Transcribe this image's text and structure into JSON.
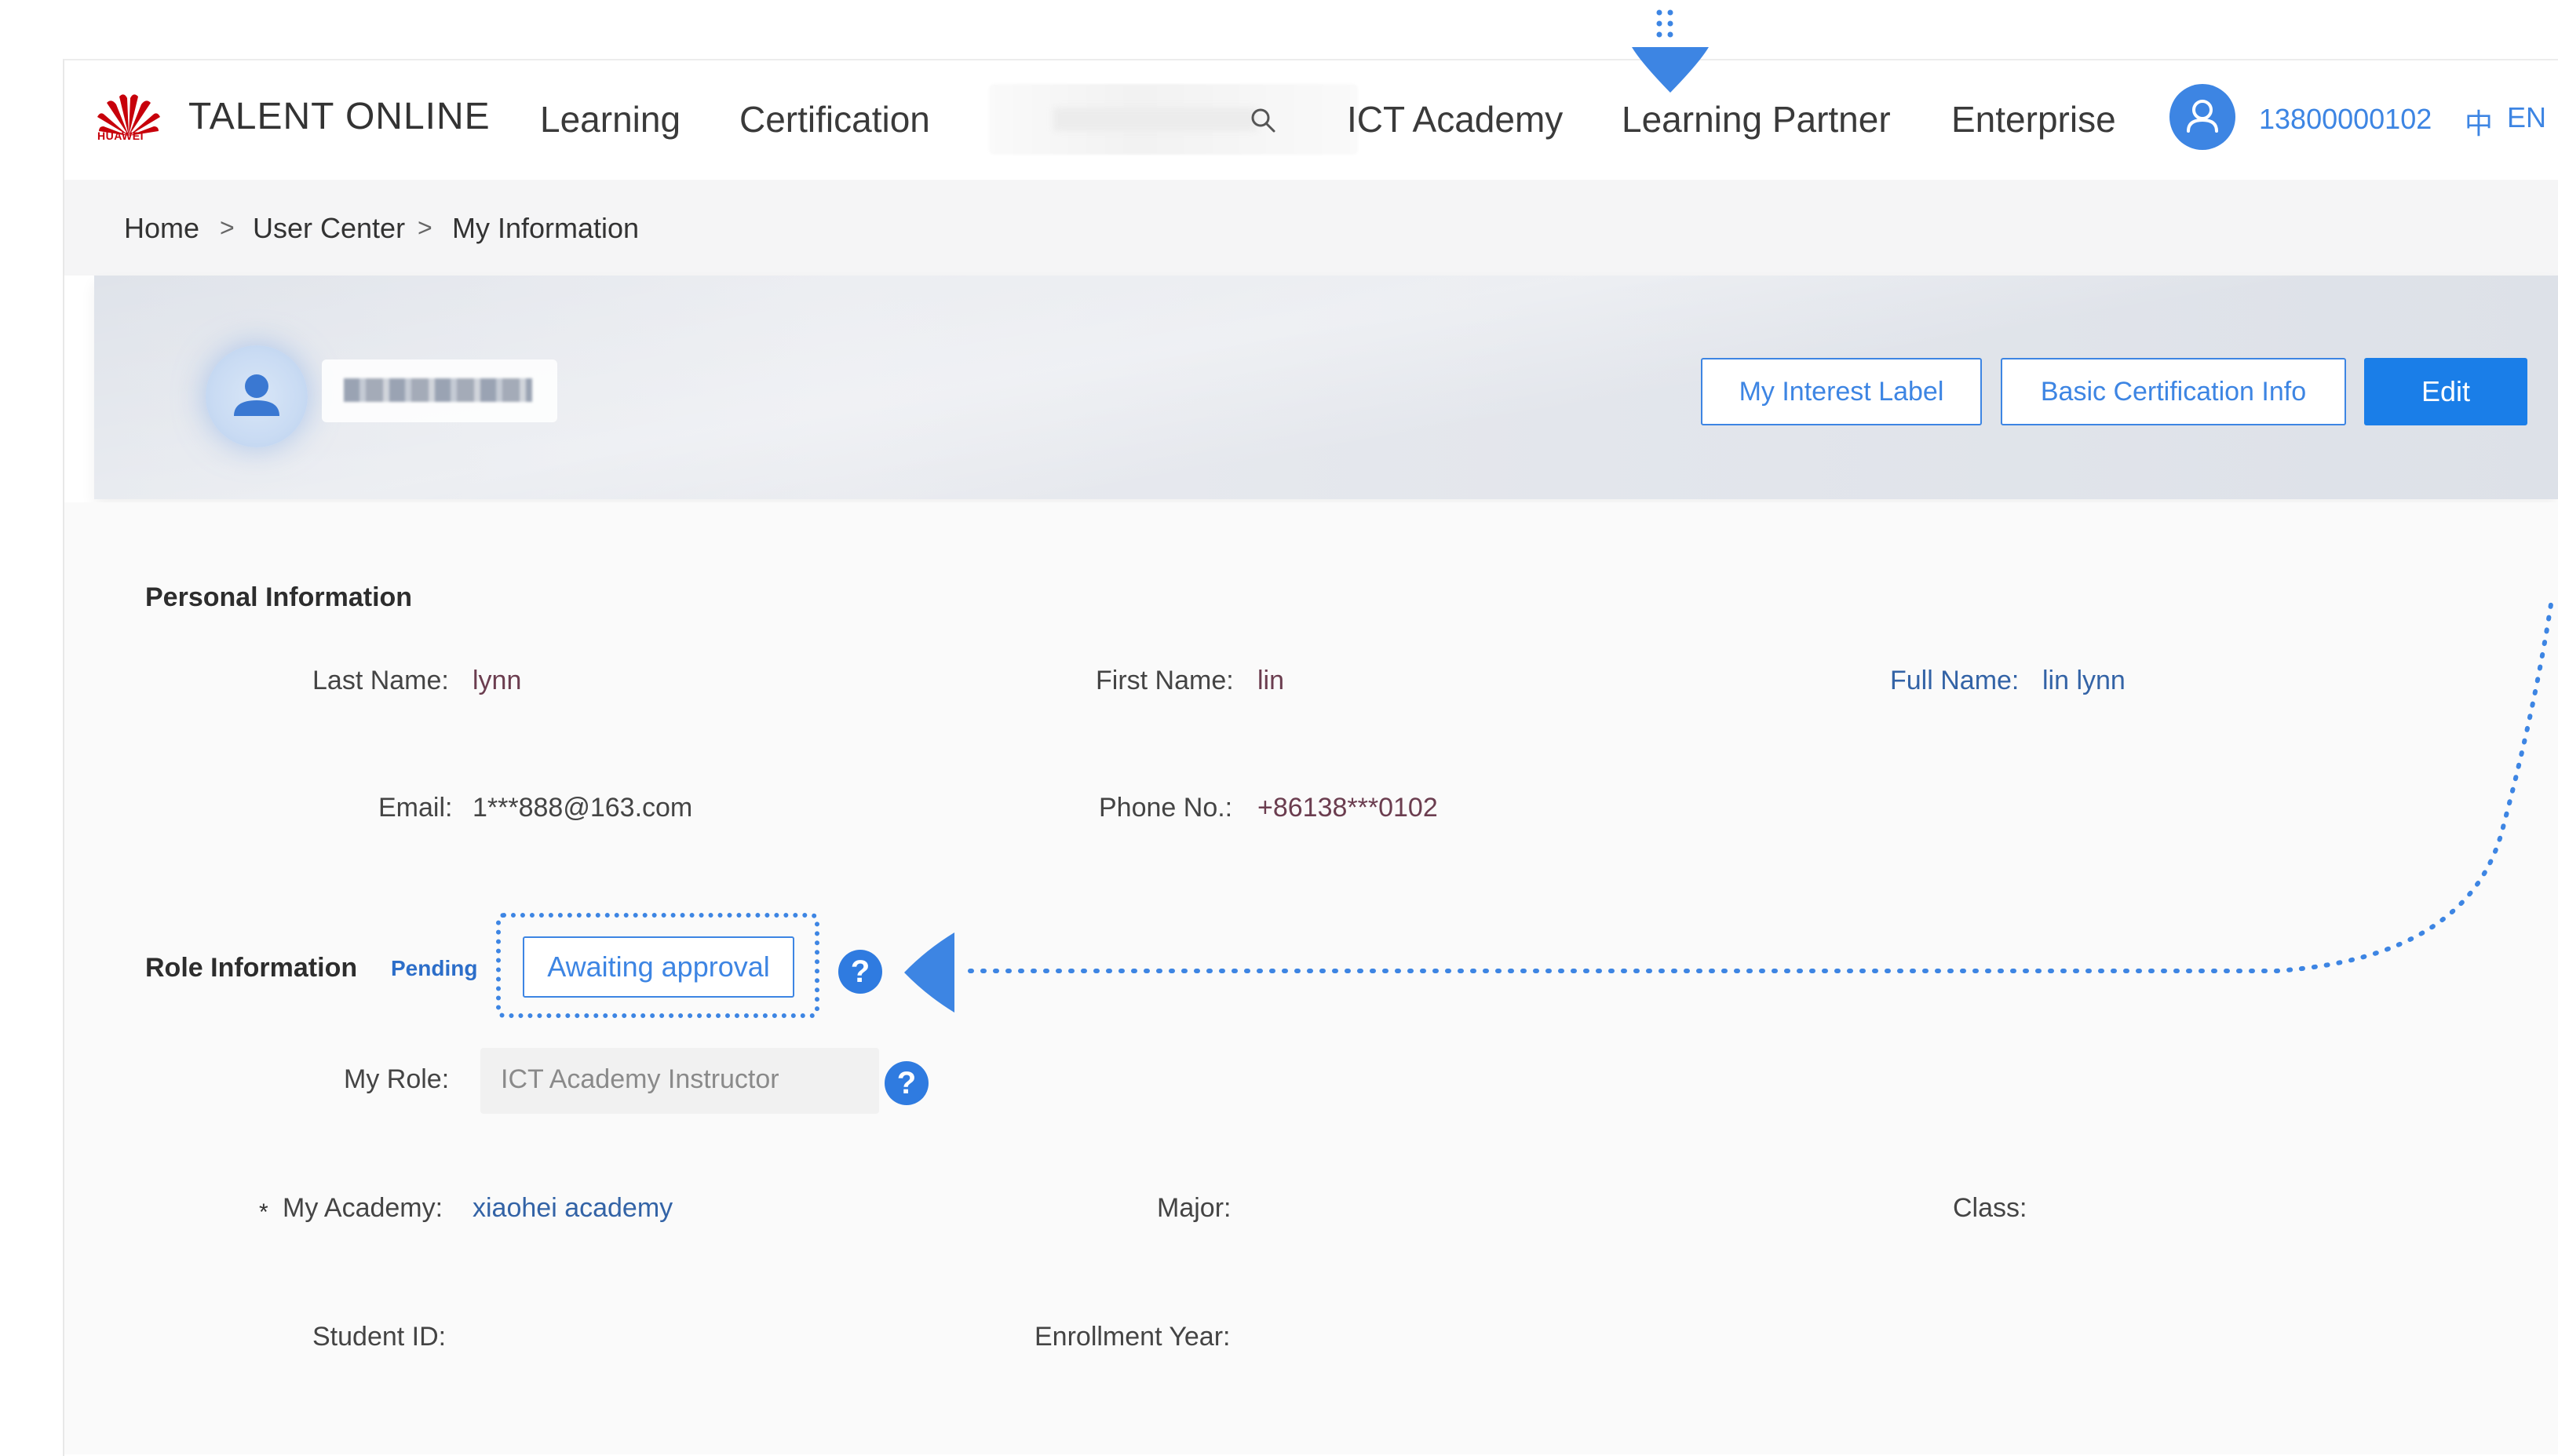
{
  "header": {
    "logo_text": "HUAWEI",
    "brand": "TALENT ONLINE",
    "nav": [
      "Learning",
      "Certification",
      "ICT Academy",
      "Learning Partner",
      "Enterprise"
    ],
    "user_phone": "13800000102",
    "lang_zh": "中",
    "lang_en": "EN"
  },
  "breadcrumb": {
    "items": [
      "Home",
      "User Center",
      "My Information"
    ],
    "separator": ">"
  },
  "banner": {
    "buttons": {
      "interest_label": "My Interest Label",
      "basic_cert": "Basic Certification Info",
      "edit": "Edit"
    }
  },
  "personal": {
    "title": "Personal Information",
    "last_name_label": "Last Name:",
    "last_name": "lynn",
    "first_name_label": "First Name:",
    "first_name": "lin",
    "full_name_label": "Full Name:",
    "full_name": "lin lynn",
    "email_label": "Email:",
    "email": "1***888@163.com",
    "phone_label": "Phone No.:",
    "phone": "+86138***0102"
  },
  "role": {
    "title": "Role Information",
    "status": "Pending",
    "awaiting": "Awaiting approval",
    "help_glyph": "?",
    "my_role_label": "My Role:",
    "my_role": "ICT Academy Instructor",
    "academy_required": "*",
    "academy_label": "My Academy:",
    "academy": "xiaohei academy",
    "major_label": "Major:",
    "class_label": "Class:",
    "student_id_label": "Student ID:",
    "enrollment_label": "Enrollment Year:"
  },
  "icons": [
    "huawei-logo-icon",
    "search-icon",
    "user-avatar-icon",
    "profile-avatar-icon",
    "help-icon",
    "down-arrow-indicator",
    "left-arrow-indicator"
  ],
  "colors": {
    "accent_blue": "#3d85e3",
    "primary_button": "#1a7ee8",
    "huawei_red": "#c7000b",
    "link_text": "#3363a6"
  }
}
